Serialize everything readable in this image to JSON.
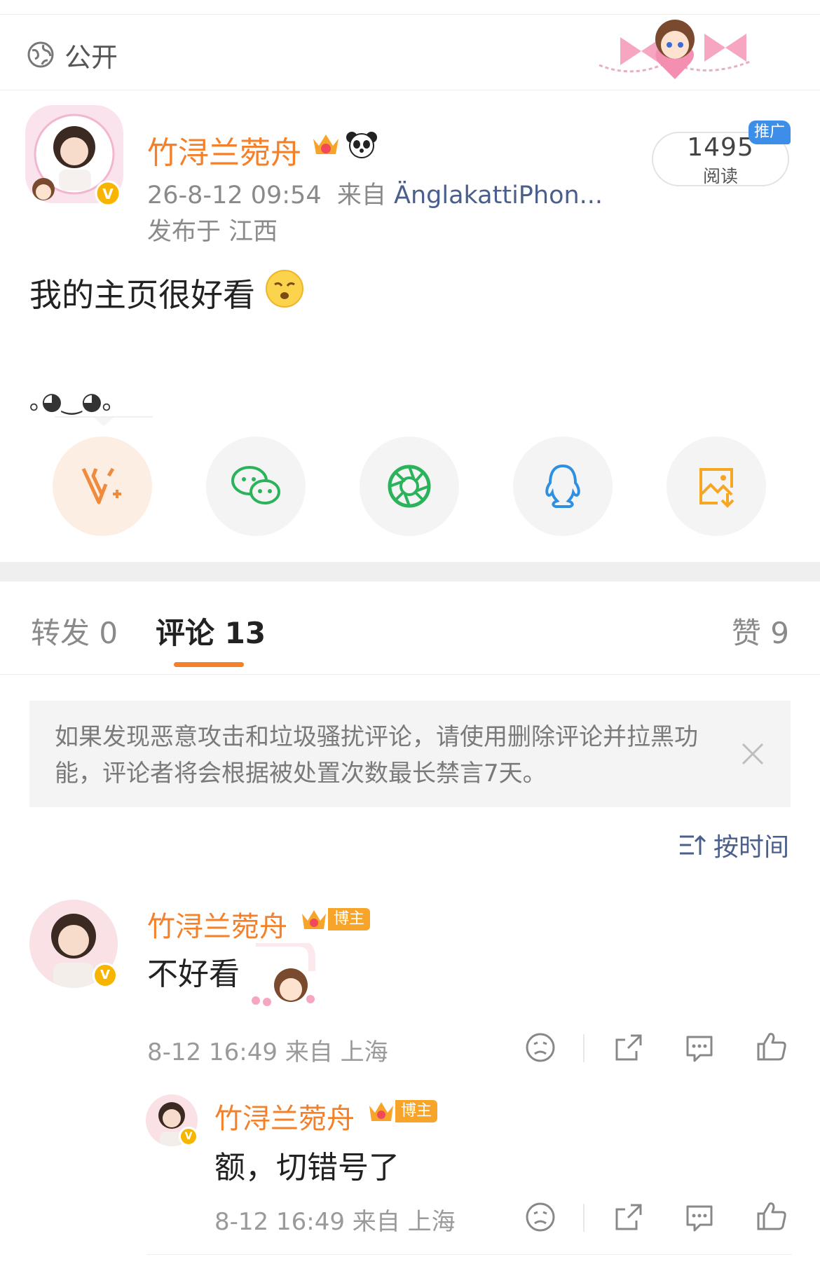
{
  "visibility": {
    "label": "公开"
  },
  "post": {
    "author": "竹浔兰菀舟",
    "time": "26-8-12 09:54",
    "from_prefix": "来自",
    "source": "ÄnglakattiPhon...",
    "location": "发布于 江西",
    "text": "我的主页很好看",
    "kaomoji": "｡◕‿◕｡",
    "read_count": "1495",
    "read_label": "阅读",
    "promo_label": "推广"
  },
  "tabs": {
    "forward": "转发 0",
    "comment": "评论 13",
    "like": "赞 9"
  },
  "notice": {
    "text": "如果发现恶意攻击和垃圾骚扰评论，请使用删除评论并拉黑功能，评论者将会根据被处置次数最长禁言7天。"
  },
  "sort": {
    "label": "按时间"
  },
  "comments": [
    {
      "name": "竹浔兰菀舟",
      "badge": "博主",
      "text": "不好看",
      "time": "8-12 16:49 来自 上海"
    },
    {
      "name": "竹浔兰菀舟",
      "badge": "博主",
      "text": "额，切错号了",
      "time": "8-12 16:49 来自 上海"
    }
  ],
  "colors": {
    "accent": "#f5802a",
    "link": "#4b5f8c",
    "promo": "#3c8ee8",
    "vip": "#f7b500"
  },
  "icons": [
    "globe-icon",
    "v-plus-icon",
    "wechat-icon",
    "moments-icon",
    "qq-icon",
    "save-image-icon",
    "close-icon",
    "sort-icon",
    "sad-face-icon",
    "share-out-icon",
    "comment-icon",
    "like-icon"
  ]
}
